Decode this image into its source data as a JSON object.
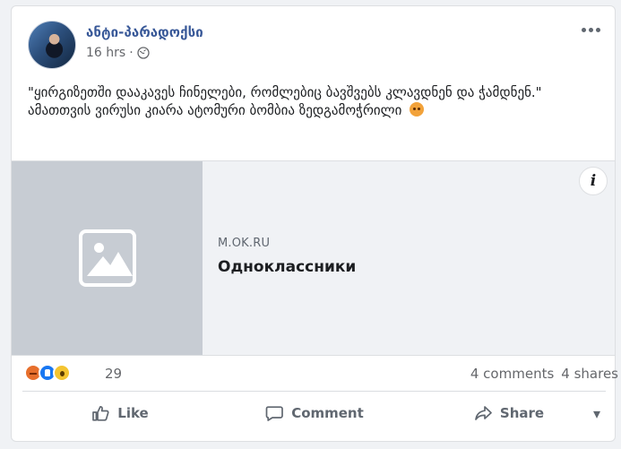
{
  "post": {
    "author_name": "ანტი-პარადოქსი",
    "time": "16 hrs",
    "separator": "·",
    "text_line_1": "\"ყირგიზეთში დააკავეს ჩინელები, რომლებიც ბავშვებს კლავდნენ და ჭამდნენ.\"",
    "text_line_2": "ამათთვის ვირუსი კიარა ატომური ბომბია ზედგამოჭრილი"
  },
  "link_preview": {
    "domain": "M.OK.RU",
    "title": "Одноклассники"
  },
  "reactions": {
    "count": "29",
    "comments": "4 comments",
    "shares": "4 shares"
  },
  "actions": {
    "like": "Like",
    "comment": "Comment",
    "share": "Share"
  },
  "icons": {
    "globe": "globe-icon",
    "more": "more-icon",
    "image_placeholder": "image-placeholder-icon",
    "info": "info-icon",
    "like": "like-icon",
    "comment": "comment-icon",
    "share": "share-icon",
    "dropdown": "chevron-down-icon"
  },
  "colors": {
    "accent": "#385898",
    "secondary_text": "#65676b",
    "panel_background": "#f0f2f5"
  }
}
